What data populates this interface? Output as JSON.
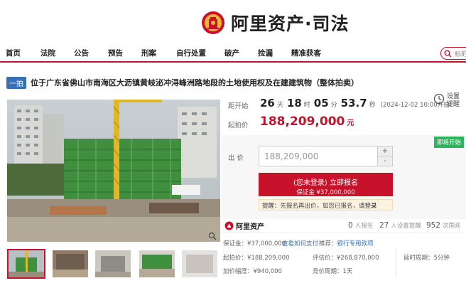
{
  "brand": {
    "name": "阿里资产·司法"
  },
  "nav": {
    "items": [
      "首页",
      "法院",
      "公告",
      "预告",
      "刑案",
      "自行处置",
      "破产",
      "捡漏",
      "精准获客"
    ],
    "search_placeholder": "标的"
  },
  "listing": {
    "badge": "一拍",
    "title": "位于广东省佛山市南海区大沥镇黄岐泌冲浔峰洲路地段的土地使用权及在建建筑物（整体拍卖）"
  },
  "countdown": {
    "label": "距开始",
    "days": "26",
    "days_unit": "天",
    "hours": "18",
    "hours_unit": "时",
    "minutes": "05",
    "minutes_unit": "分",
    "seconds": "53.7",
    "seconds_unit": "秒",
    "start_note": "(2024-12-02 10:00开拍)"
  },
  "remind": {
    "line1": "设置",
    "line2": "提醒"
  },
  "start_price": {
    "label": "起拍价",
    "value": "188,209,000",
    "unit": "元"
  },
  "status_tag": "即将开始",
  "bid": {
    "label": "出 价",
    "value": "188,209,000",
    "increase": "+",
    "decrease": "-"
  },
  "signup": {
    "line1": "(您未登录) 立即报名",
    "line2": "保证金 ¥37,000,000"
  },
  "notice": {
    "text": "提醒：先报名再出价，如您已报名，请",
    "link": "登录"
  },
  "stats": {
    "logo": "阿里资产",
    "signups": {
      "num": "0",
      "label": "人报名"
    },
    "reminders": {
      "num": "27",
      "label": "人设置提醒"
    },
    "views": {
      "num": "952",
      "label": "次围观"
    }
  },
  "info": {
    "deposit_label": "保证金：",
    "deposit_value": "¥37,000,000",
    "deposit_link": "查看如何支付",
    "recommend_label": "推荐：",
    "recommend_link": "银行专用款项",
    "start_label": "起拍价：",
    "start_value": "¥188,209,000",
    "assess_label": "评估价：",
    "assess_value": "¥268,870,000",
    "increment_label": "加价幅度：",
    "increment_value": "¥940,000",
    "cycle_label": "竞价周期：",
    "cycle_value": "1天",
    "delay_label": "延时周期：",
    "delay_value": "5分钟"
  },
  "colors": {
    "accent": "#c8112a",
    "link": "#3a6fb8",
    "status_green": "#2db55d"
  }
}
